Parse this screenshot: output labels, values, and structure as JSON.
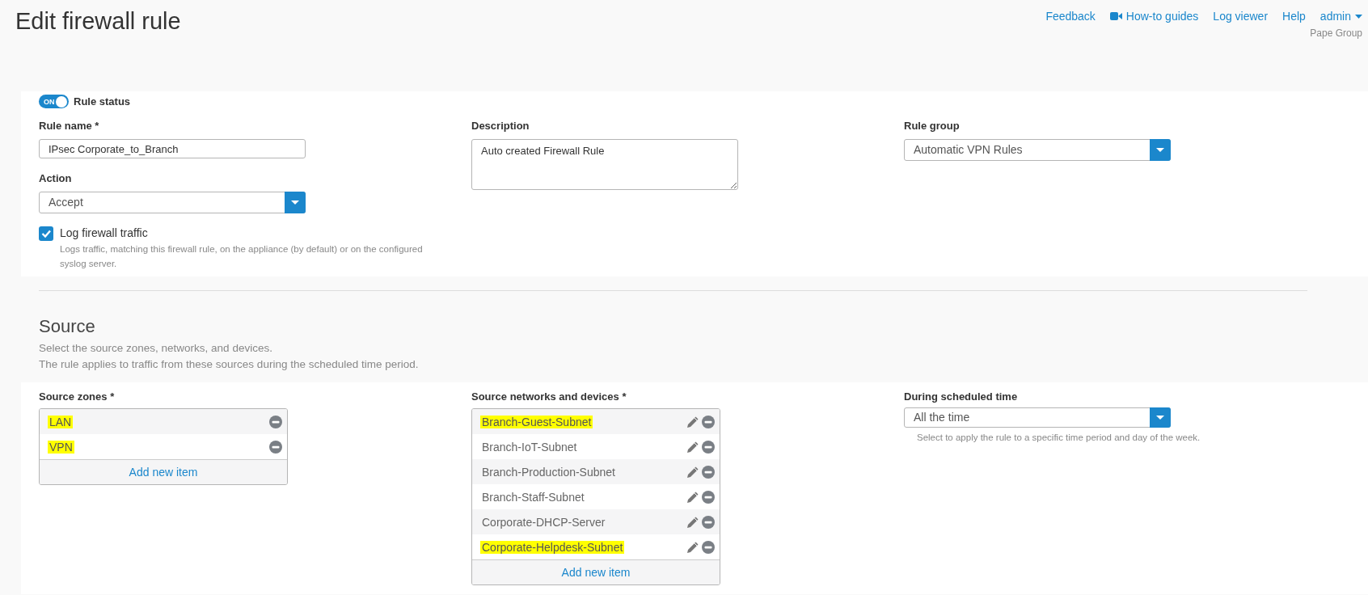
{
  "page": {
    "title": "Edit firewall rule"
  },
  "nav": {
    "links": [
      {
        "label": "Feedback",
        "kind": "link"
      },
      {
        "label": "How-to guides",
        "kind": "video"
      },
      {
        "label": "Log viewer",
        "kind": "link"
      },
      {
        "label": "Help",
        "kind": "link"
      },
      {
        "label": "admin",
        "kind": "menu"
      }
    ],
    "organization": "Pape Group"
  },
  "rule": {
    "status": {
      "label": "Rule status",
      "on": true,
      "toggle_text": "ON"
    },
    "name": {
      "label": "Rule name *",
      "value": "IPsec Corporate_to_Branch"
    },
    "action": {
      "label": "Action",
      "value": "Accept"
    },
    "log": {
      "label": "Log firewall traffic",
      "checked": true,
      "help": "Logs traffic, matching this firewall rule, on the appliance (by default) or on the configured syslog server."
    },
    "description": {
      "label": "Description",
      "value": "Auto created Firewall Rule"
    },
    "group": {
      "label": "Rule group",
      "value": "Automatic VPN Rules"
    }
  },
  "source": {
    "title": "Source",
    "description": [
      "Select the source zones, networks, and devices.",
      "The rule applies to traffic from these sources during the scheduled time period."
    ],
    "zones": {
      "label": "Source zones *",
      "editable": false,
      "add_label": "Add new item",
      "items": [
        {
          "name": "LAN",
          "highlighted": true
        },
        {
          "name": "VPN",
          "highlighted": true
        }
      ]
    },
    "networks": {
      "label": "Source networks and devices *",
      "editable": true,
      "add_label": "Add new item",
      "items": [
        {
          "name": "Branch-Guest-Subnet",
          "highlighted": true
        },
        {
          "name": "Branch-IoT-Subnet",
          "highlighted": false
        },
        {
          "name": "Branch-Production-Subnet",
          "highlighted": false
        },
        {
          "name": "Branch-Staff-Subnet",
          "highlighted": false
        },
        {
          "name": "Corporate-DHCP-Server",
          "highlighted": false
        },
        {
          "name": "Corporate-Helpdesk-Subnet",
          "highlighted": true
        }
      ]
    },
    "schedule": {
      "label": "During scheduled time",
      "value": "All the time",
      "hint": "Select to apply the rule to a specific time period and day of the week."
    }
  }
}
